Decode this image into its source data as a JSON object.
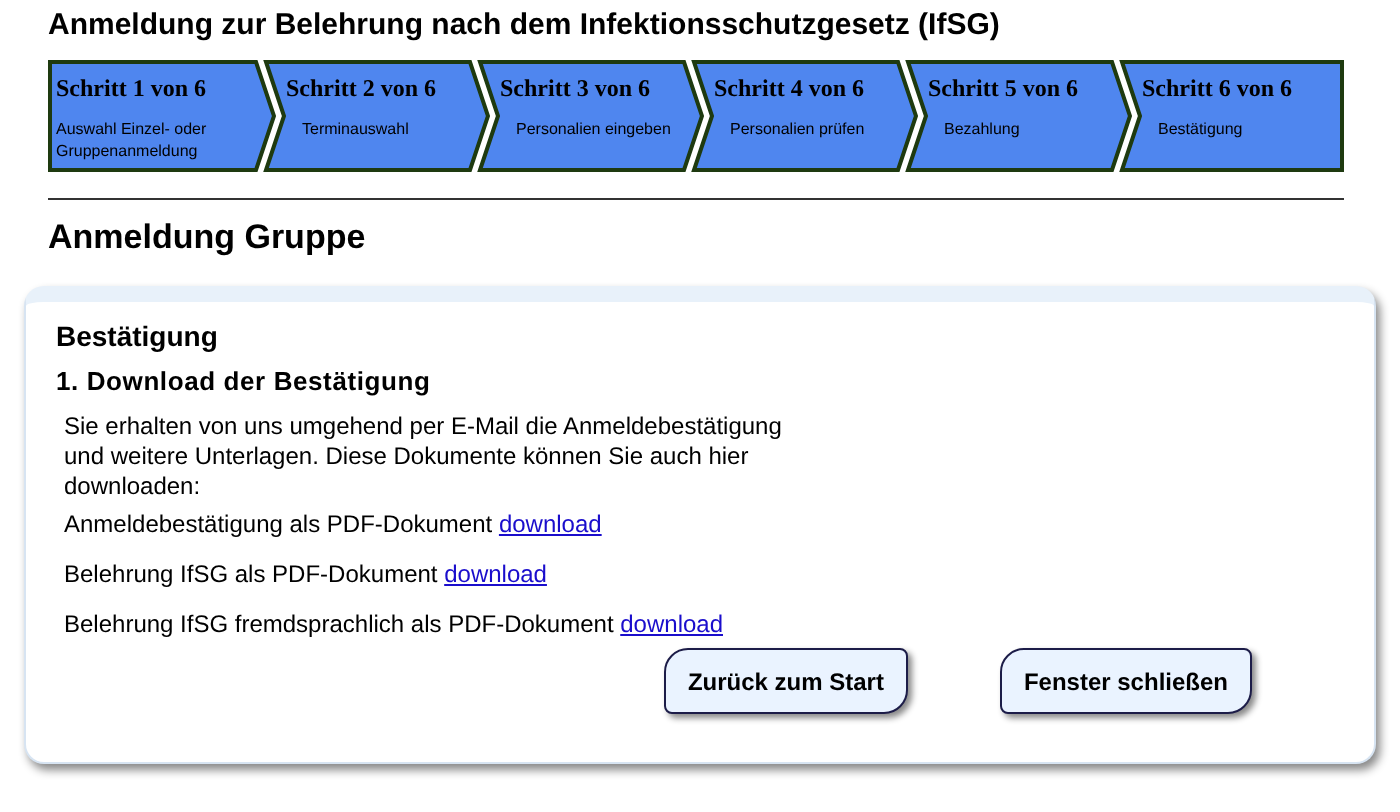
{
  "page_title": "Anmeldung zur Belehrung nach dem Infektionsschutzgesetz (IfSG)",
  "steps": [
    {
      "kind": "first",
      "label": "Schritt 1 von 6",
      "description": "Auswahl Einzel- oder Gruppenanmeldung"
    },
    {
      "kind": "middle",
      "label": "Schritt 2 von 6",
      "description": "Terminauswahl"
    },
    {
      "kind": "middle",
      "label": "Schritt 3 von 6",
      "description": "Personalien eingeben"
    },
    {
      "kind": "middle",
      "label": "Schritt 4 von 6",
      "description": "Personalien prüfen"
    },
    {
      "kind": "middle",
      "label": "Schritt 5 von 6",
      "description": "Bezahlung"
    },
    {
      "kind": "last",
      "label": "Schritt 6 von 6",
      "description": "Bestätigung"
    }
  ],
  "section_title": "Anmeldung Gruppe",
  "panel": {
    "title": "Bestätigung",
    "subtitle": "1. Download der Bestätigung",
    "intro": "Sie erhalten von uns umgehend per E-Mail die Anmeldebestätigung und weitere Unterlagen. Diese Dokumente können Sie auch hier downloaden:",
    "downloads": [
      {
        "text": "Anmeldebestätigung als PDF-Dokument",
        "link": "download"
      },
      {
        "text": "Belehrung IfSG als PDF-Dokument",
        "link": "download"
      },
      {
        "text": "Belehrung IfSG fremdsprachlich als PDF-Dokument",
        "link": "download"
      }
    ],
    "buttons": [
      "Zurück zum Start",
      "Fenster schließen"
    ]
  }
}
